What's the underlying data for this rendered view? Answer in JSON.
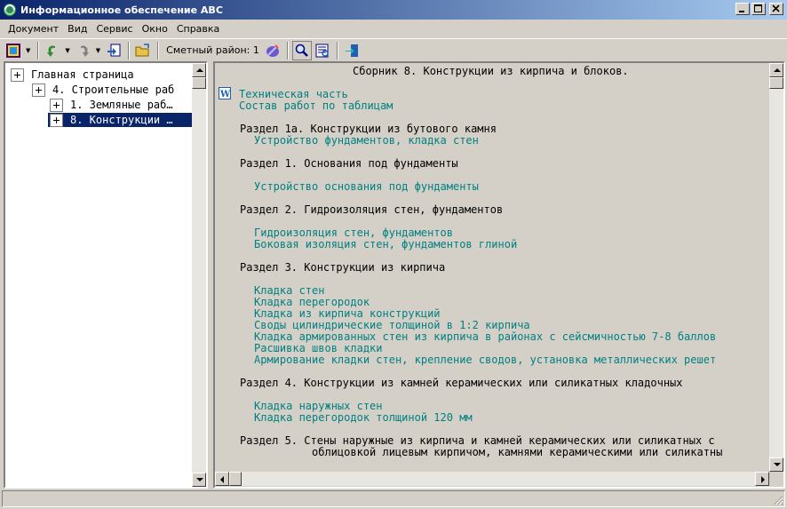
{
  "window": {
    "title": "Информационное обеспечение АВС",
    "minimize": "_",
    "maximize": "□",
    "close": "×"
  },
  "menu": [
    "Документ",
    "Вид",
    "Сервис",
    "Окно",
    "Справка"
  ],
  "toolbar": {
    "region_label": "Сметный район: 1",
    "icons": [
      "document-app-icon",
      "undo-icon",
      "redo-icon",
      "export-icon",
      "open-folder-icon",
      "region-pen-icon",
      "search-icon",
      "catalog-icon",
      "exit-icon"
    ]
  },
  "tree": {
    "nodes": [
      {
        "label": "Главная страница",
        "level": 0,
        "selected": false
      },
      {
        "label": "4. Строительные раб",
        "level": 1,
        "selected": false
      },
      {
        "label": "1. Земляные раб…",
        "level": 2,
        "selected": false
      },
      {
        "label": "8. Конструкции …",
        "level": 2,
        "selected": true
      }
    ]
  },
  "document": {
    "title": "Сборник 8. Конструкции из кирпича и блоков.",
    "top_links": [
      "Техническая часть",
      "Состав работ по таблицам"
    ],
    "sections": [
      {
        "heading": "Раздел 1а. Конструкции из бутового камня",
        "links": [
          "Устройство фундаментов, кладка стен"
        ]
      },
      {
        "heading": "Раздел 1. Основания под фундаменты",
        "links": [
          "Устройство основания под фундаменты"
        ]
      },
      {
        "heading": "Раздел 2. Гидроизоляция стен, фундаментов",
        "links": [
          "Гидроизоляция стен, фундаментов",
          "Боковая изоляция стен, фундаментов глиной"
        ]
      },
      {
        "heading": "Раздел 3. Конструкции из кирпича",
        "links": [
          "Кладка стен",
          "Кладка перегородок",
          "Кладка из кирпича конструкций",
          "Своды цилиндрические толщиной в 1:2 кирпича",
          "Кладка армированных стен из кирпича в районах с сейсмичностью 7-8 баллов",
          "Расшивка швов кладки",
          "Армирование кладки стен, крепление сводов, установка металлических решет"
        ]
      },
      {
        "heading": "Раздел 4. Конструкции из камней керамических или силикатных кладочных",
        "links": [
          "Кладка наружных стен",
          "Кладка перегородок толщиной 120 мм"
        ]
      },
      {
        "heading": "Раздел 5. Стены наружные из кирпича и камней керамических или силикатных с",
        "heading2": "облицовкой лицевым кирпичом, камнями керамическими или силикатны",
        "links": []
      }
    ]
  },
  "colors": {
    "link": "#008080",
    "selection": "#0a246a",
    "titlebar_start": "#0a246a",
    "titlebar_end": "#a6caf0",
    "face": "#d4d0c8"
  }
}
